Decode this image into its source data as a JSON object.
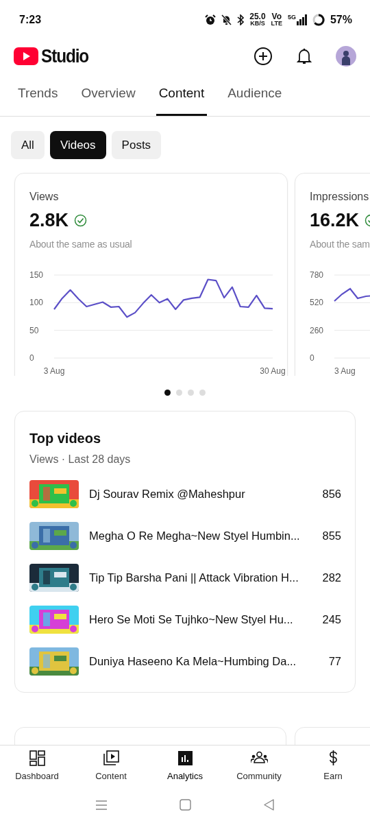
{
  "status_bar": {
    "time": "7:23",
    "speed": "25.0",
    "speed_unit": "KB/S",
    "volte_top": "Vo",
    "volte_bottom": "LTE",
    "network": "5G",
    "battery": "57%"
  },
  "header": {
    "logo_text": "Studio"
  },
  "tabs": [
    {
      "label": "Trends",
      "selected": false
    },
    {
      "label": "Overview",
      "selected": false
    },
    {
      "label": "Content",
      "selected": true
    },
    {
      "label": "Audience",
      "selected": false
    }
  ],
  "chips": [
    {
      "label": "All",
      "selected": false
    },
    {
      "label": "Videos",
      "selected": true
    },
    {
      "label": "Posts",
      "selected": false
    }
  ],
  "metric_cards": [
    {
      "title": "Views",
      "value": "2.8K",
      "note": "About the same as usual",
      "chart_data": {
        "type": "line",
        "categories": [
          "3 Aug",
          null,
          null,
          null,
          null,
          null,
          null,
          null,
          null,
          null,
          null,
          null,
          null,
          null,
          null,
          null,
          null,
          null,
          null,
          null,
          null,
          null,
          null,
          null,
          null,
          null,
          null,
          "30 Aug"
        ],
        "ylim": [
          0,
          150
        ],
        "yticks": [
          0,
          50,
          100,
          150
        ],
        "series": [
          {
            "color": "#5b4fc7",
            "values": [
              88,
              108,
              123,
              107,
              93,
              97,
              101,
              92,
              93,
              74,
              82,
              99,
              114,
              100,
              107,
              88,
              105,
              108,
              110,
              142,
              140,
              109,
              128,
              93,
              92,
              113,
              90,
              89
            ]
          }
        ]
      }
    },
    {
      "title": "Impressions",
      "value": "16.2K",
      "note": "About the sam",
      "axis_labels": [
        "780",
        "520",
        "260",
        "0"
      ],
      "x_label": "3 Aug"
    }
  ],
  "pager": [
    {
      "selected": true
    },
    {
      "selected": false
    },
    {
      "selected": false
    },
    {
      "selected": false
    }
  ],
  "top_videos": {
    "title": "Top videos",
    "subtitle": "Views · Last 28 days",
    "rows": [
      {
        "kind": "picture",
        "title": "Dj Sourav Remix @Maheshpur",
        "views": "856"
      },
      {
        "kind": "picture",
        "title": "Megha O Re Megha~New Styel Humbin...",
        "views": "855"
      },
      {
        "kind": "picture",
        "title": "Tip Tip Barsha Pani || Attack Vibration H...",
        "views": "282"
      },
      {
        "kind": "picture",
        "title": "Hero Se Moti Se Tujhko~New Styel Hu...",
        "views": "245"
      },
      {
        "kind": "picture",
        "title": "Duniya Haseeno Ka Mela~Humbing Da...",
        "views": "77"
      }
    ]
  },
  "bottom_nav": [
    {
      "label": "Dashboard",
      "selected": false
    },
    {
      "label": "Content",
      "selected": false
    },
    {
      "label": "Analytics",
      "selected": true
    },
    {
      "label": "Community",
      "selected": false
    },
    {
      "label": "Earn",
      "selected": false
    }
  ]
}
